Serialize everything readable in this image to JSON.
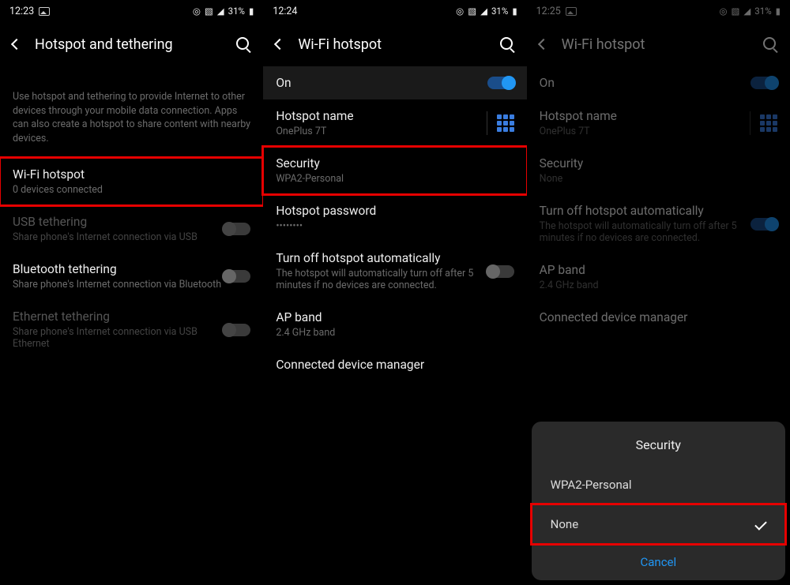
{
  "panel1": {
    "status": {
      "time": "12:23",
      "battery": "31%"
    },
    "header": {
      "title": "Hotspot and tethering"
    },
    "desc": "Use hotspot and tethering to provide Internet to other devices through your mobile data connection. Apps can also create a hotspot to share content with nearby devices.",
    "items": {
      "wifi": {
        "title": "Wi-Fi hotspot",
        "sub": "0 devices connected"
      },
      "usb": {
        "title": "USB tethering",
        "sub": "Share phone's Internet connection via USB"
      },
      "bt": {
        "title": "Bluetooth tethering",
        "sub": "Share phone's Internet connection via Bluetooth"
      },
      "eth": {
        "title": "Ethernet tethering",
        "sub": "Share phone's Internet connection via USB Ethernet"
      }
    }
  },
  "panel2": {
    "status": {
      "time": "12:24",
      "battery": "31%"
    },
    "header": {
      "title": "Wi-Fi hotspot"
    },
    "items": {
      "on": {
        "title": "On"
      },
      "name": {
        "title": "Hotspot name",
        "sub": "OnePlus 7T"
      },
      "sec": {
        "title": "Security",
        "sub": "WPA2-Personal"
      },
      "pw": {
        "title": "Hotspot password",
        "sub": "••••••••"
      },
      "auto": {
        "title": "Turn off hotspot automatically",
        "sub": "The hotspot will automatically turn off after 5 minutes if no devices are connected."
      },
      "band": {
        "title": "AP band",
        "sub": "2.4 GHz band"
      },
      "conn": {
        "title": "Connected device manager"
      }
    }
  },
  "panel3": {
    "status": {
      "time": "12:25",
      "battery": "31%"
    },
    "header": {
      "title": "Wi-Fi hotspot"
    },
    "items": {
      "on": {
        "title": "On"
      },
      "name": {
        "title": "Hotspot name",
        "sub": "OnePlus 7T"
      },
      "sec": {
        "title": "Security",
        "sub": "None"
      },
      "auto": {
        "title": "Turn off hotspot automatically",
        "sub": "The hotspot will automatically turn off after 5 minutes if no devices are connected."
      },
      "band": {
        "title": "AP band",
        "sub": "2.4 GHz band"
      },
      "conn": {
        "title": "Connected device manager"
      }
    },
    "sheet": {
      "title": "Security",
      "options": {
        "wpa2": "WPA2-Personal",
        "none": "None"
      },
      "cancel": "Cancel"
    }
  }
}
